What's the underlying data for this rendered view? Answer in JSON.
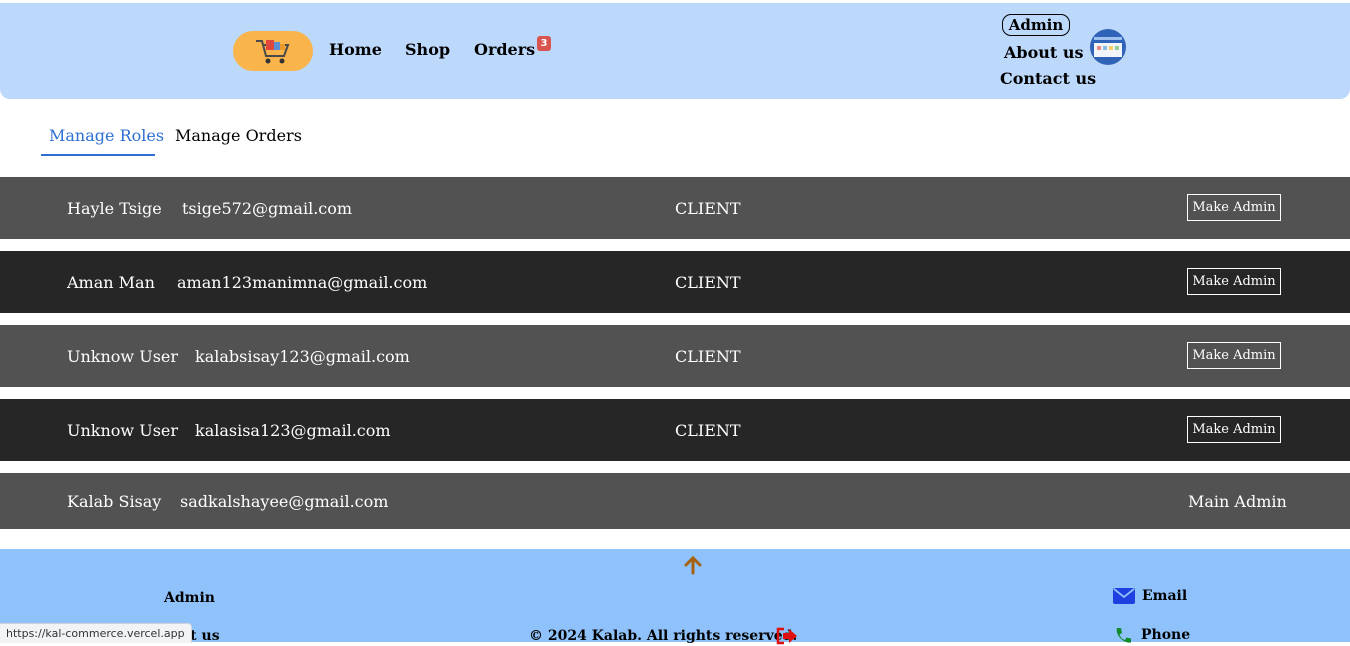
{
  "nav": {
    "home": "Home",
    "shop": "Shop",
    "orders": "Orders",
    "orders_badge": "3",
    "admin": "Admin",
    "about": "About us",
    "contact": "Contact us"
  },
  "tabs": {
    "manage_roles": "Manage Roles",
    "manage_orders": "Manage Orders"
  },
  "users": [
    {
      "name": "Hayle Tsige",
      "email": "tsige572@gmail.com",
      "role": "CLIENT",
      "action": "Make Admin"
    },
    {
      "name": "Aman Man",
      "email": "aman123manimna@gmail.com",
      "role": "CLIENT",
      "action": "Make Admin"
    },
    {
      "name": "Unknow User",
      "email": "kalabsisay123@gmail.com",
      "role": "CLIENT",
      "action": "Make Admin"
    },
    {
      "name": "Unknow User",
      "email": "kalasisa123@gmail.com",
      "role": "CLIENT",
      "action": "Make Admin"
    },
    {
      "name": "Kalab Sisay",
      "email": "sadkalshayee@gmail.com",
      "role": "",
      "status": "Main Admin"
    }
  ],
  "footer": {
    "admin": "Admin",
    "about": "About us",
    "copyright": "© 2024 Kalab. All rights reserved.",
    "email": "Email",
    "phone": "Phone"
  },
  "status_url": "https://kal-commerce.vercel.app",
  "colors": {
    "header_bg": "#bcd8fb",
    "footer_bg": "#8fc1fa",
    "accent": "#2d6fd2",
    "logo_bg": "#f9b54c",
    "row_light": "#525252",
    "row_dark": "#262626"
  }
}
